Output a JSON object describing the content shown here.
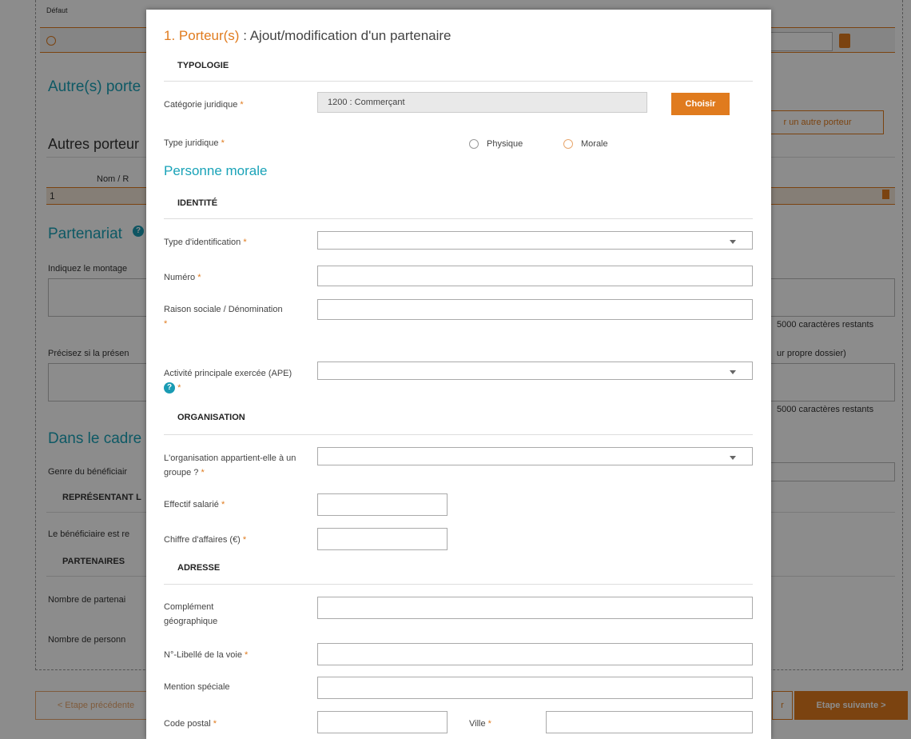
{
  "background": {
    "col_default": "Défaut",
    "heading_autres": "Autre(s) porte",
    "button_autre_porteur": "r un autre porteur",
    "subheading_autres_porteurs": "Autres porteur",
    "col_nom": "Nom / R",
    "row_one": "1",
    "heading_partenariat": "Partenariat",
    "label_montage": "Indiquez le montage",
    "chars_left_1": "5000 caractères restants",
    "label_precisez": "Précisez si la présen",
    "note_dossier": "ur propre dossier)",
    "chars_left_2": "5000 caractères restants",
    "heading_cadre": "Dans le cadre",
    "label_genre": "Genre du bénéficiair",
    "section_representant": "REPRÉSENTANT L",
    "label_beneficiaire": "Le bénéficiaire est re",
    "section_partenaires": "PARTENAIRES",
    "label_nombre_partenaires": "Nombre de partenai",
    "label_nombre_personnes": "Nombre de personn",
    "button_prev": "< Etape précédente",
    "button_next": "Etape suivante >",
    "button_partial": "r"
  },
  "modal": {
    "title_number": "1. Porteur(s)",
    "title_text": " : Ajout/modification d'un partenaire",
    "section_typologie": "TYPOLOGIE",
    "label_categorie": "Catégorie juridique",
    "value_categorie": "1200 : Commerçant",
    "button_choisir": "Choisir",
    "label_type_juridique": "Type juridique",
    "radio_physique": "Physique",
    "radio_morale": "Morale",
    "subheading_personne_morale": "Personne morale",
    "section_identite": "IDENTITÉ",
    "label_type_identification": "Type d'identification",
    "label_numero": "Numéro",
    "label_raison_sociale": "Raison sociale / Dénomination",
    "label_activite": "Activité principale exercée (APE)",
    "section_organisation": "ORGANISATION",
    "label_groupe": "L'organisation appartient-elle à un groupe ?",
    "label_effectif": "Effectif salarié",
    "label_chiffre": "Chiffre d'affaires (€)",
    "section_adresse": "ADRESSE",
    "label_complement": "Complément géographique",
    "label_voie": "N°-Libellé de la voie",
    "label_mention": "Mention spéciale",
    "label_code_postal": "Code postal",
    "label_ville": "Ville",
    "required_mark": "*",
    "help_icon": "?"
  },
  "colors": {
    "accent_orange": "#e07b1e",
    "heading_teal": "#1aa3b8"
  }
}
